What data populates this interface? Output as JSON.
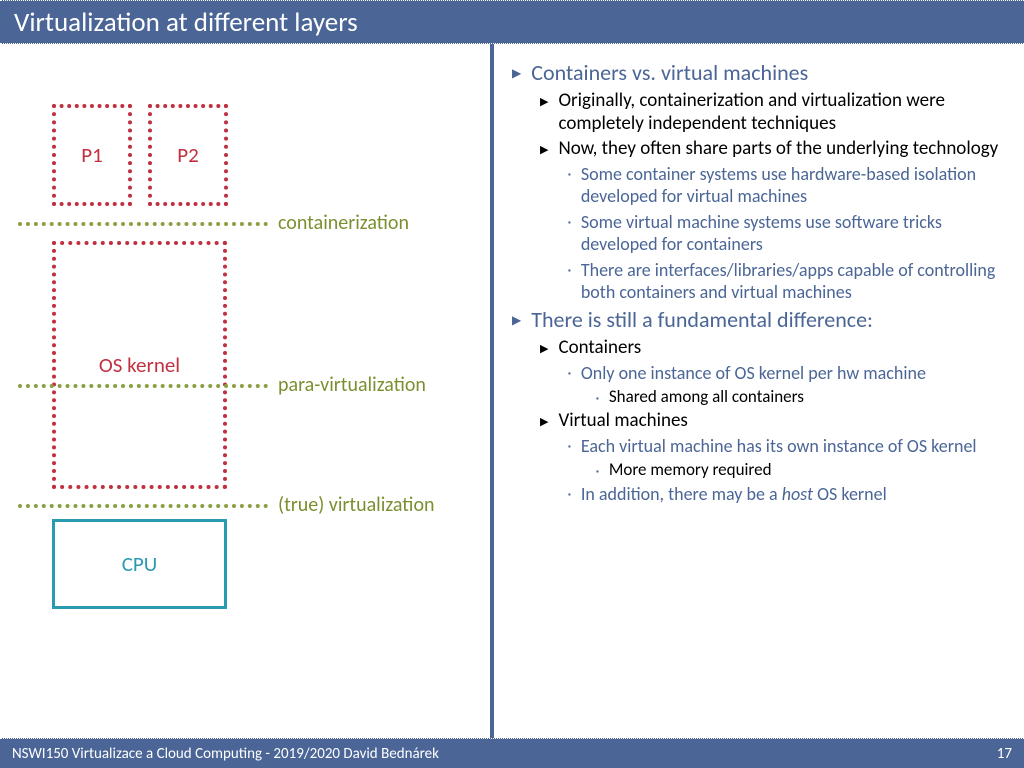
{
  "title": "Virtualization at different layers",
  "footer": {
    "left": "NSWI150 Virtualizace a Cloud Computing - 2019/2020 David Bednárek",
    "page": "17"
  },
  "diagram": {
    "p1": "P1",
    "p2": "P2",
    "kernel": "OS kernel",
    "cpu": "CPU",
    "l1": "containerization",
    "l2": "para-virtualization",
    "l3": "(true) virtualization"
  },
  "c": {
    "b1": "Containers vs. virtual machines",
    "b1a": "Originally, containerization and virtualization were completely independent techniques",
    "b1b": "Now, they often share parts of the underlying technology",
    "b1b1": "Some container systems use hardware-based isolation developed for virtual machines",
    "b1b2": "Some virtual machine systems use software tricks developed for containers",
    "b1b3": "There are interfaces/libraries/apps capable of controlling both containers and virtual machines",
    "b2": "There is still a fundamental difference:",
    "b2a": "Containers",
    "b2a1": "Only one instance of OS kernel per hw machine",
    "b2a1a": "Shared among all containers",
    "b2b": "Virtual machines",
    "b2b1": "Each virtual machine has its own instance of OS kernel",
    "b2b1a": "More memory required",
    "b2b2pre": "In addition, there may be a ",
    "b2b2em": "host",
    "b2b2suf": " OS kernel"
  }
}
